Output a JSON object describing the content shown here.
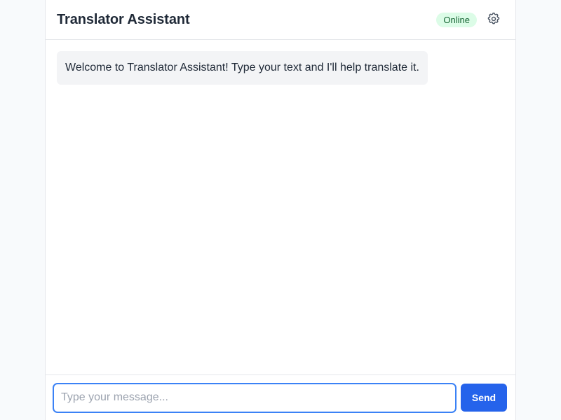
{
  "header": {
    "title": "Translator Assistant",
    "status": "Online",
    "settings_icon": "gear-icon"
  },
  "messages": [
    {
      "role": "assistant",
      "text": "Welcome to Translator Assistant! Type your text and I'll help translate it."
    }
  ],
  "composer": {
    "input_value": "",
    "placeholder": "Type your message...",
    "send_label": "Send"
  },
  "colors": {
    "accent": "#2563eb",
    "status_bg": "#dcfce7",
    "status_text": "#166534",
    "bubble_bg": "#f3f4f6"
  }
}
